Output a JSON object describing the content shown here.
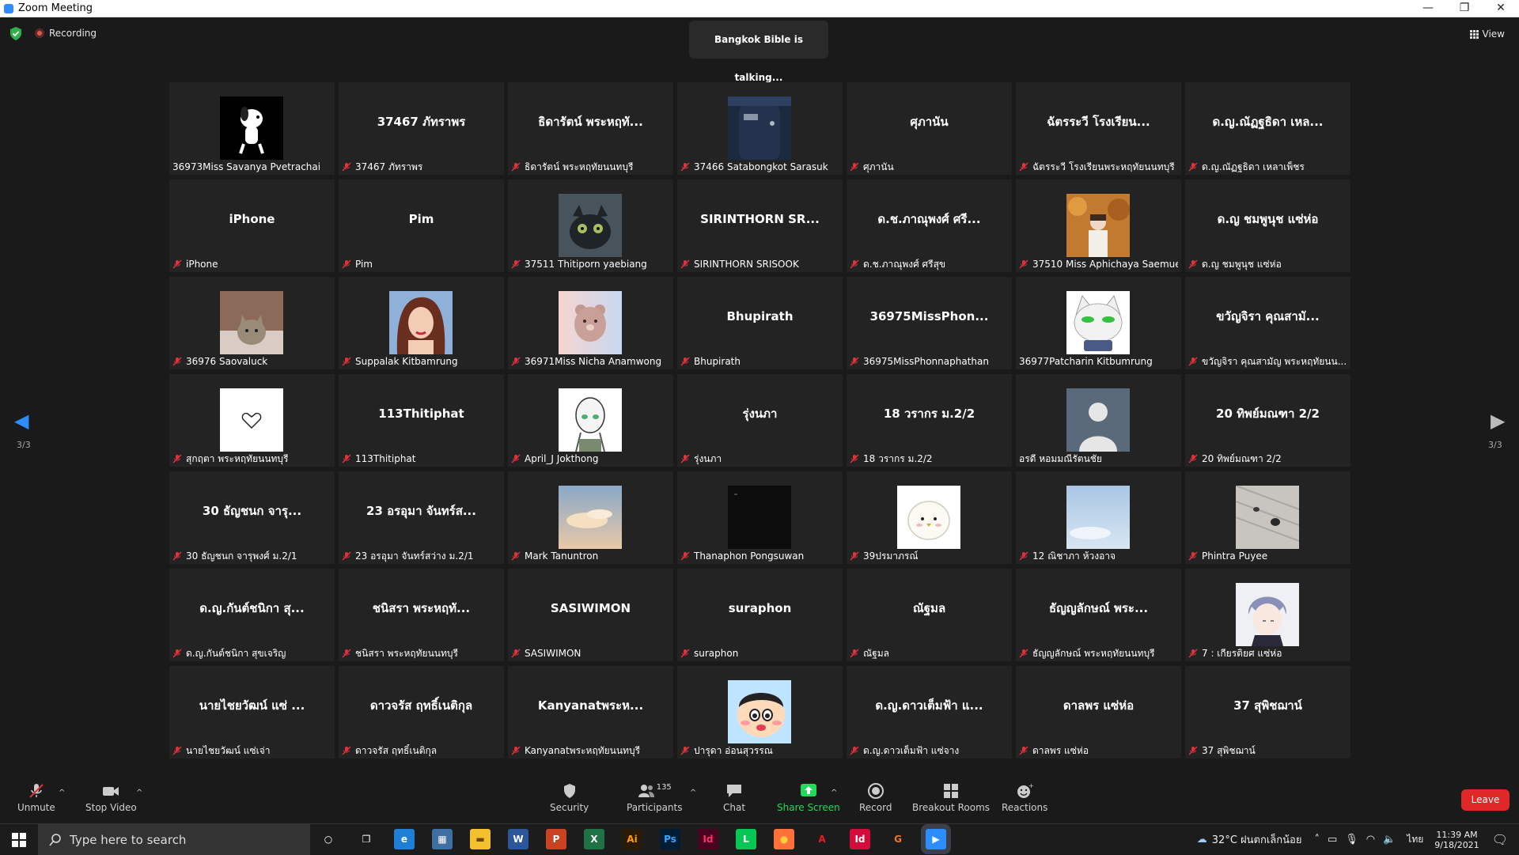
{
  "window": {
    "title": "Zoom Meeting",
    "controls": [
      "—",
      "❐",
      "✕"
    ]
  },
  "meeting": {
    "recording_label": "Recording",
    "talking_banner": "Bangkok Bible is talking...",
    "view_label": "View",
    "page_left": "3/3",
    "page_right": "3/3"
  },
  "tiles": [
    {
      "big": "",
      "label": "36973Miss Savanya Pvetrachai",
      "pic": "snoopy",
      "muted": false
    },
    {
      "big": "37467 ภัทราพร",
      "label": "37467 ภัทราพร",
      "pic": "",
      "muted": true
    },
    {
      "big": "ธิดารัตน์ พระหฤทั...",
      "label": "ธิดารัตน์ พระหฤทัยนนทบุรี",
      "pic": "",
      "muted": true
    },
    {
      "big": "",
      "label": "37466 Satabongkot Sarasuk",
      "pic": "uniform",
      "muted": true
    },
    {
      "big": "ศุภานัน",
      "label": "ศุภานัน",
      "pic": "",
      "muted": true
    },
    {
      "big": "ฉัตรระวี โรงเรียน...",
      "label": "ฉัตรระวี โรงเรียนพระหฤทัยนนทบุรี",
      "pic": "",
      "muted": true
    },
    {
      "big": "ด.ญ.ณัฏฐธิดา เหล...",
      "label": "ด.ญ.ณัฏฐธิดา เหลาเพ็ชร",
      "pic": "",
      "muted": true
    },
    {
      "big": "iPhone",
      "label": "iPhone",
      "pic": "",
      "muted": true
    },
    {
      "big": "Pim",
      "label": "Pim",
      "pic": "",
      "muted": true
    },
    {
      "big": "",
      "label": "37511 Thitiporn yaebiang",
      "pic": "toothless",
      "muted": true
    },
    {
      "big": "SIRINTHORN SR...",
      "label": "SIRINTHORN SRISOOK",
      "pic": "",
      "muted": true
    },
    {
      "big": "ด.ช.ภาณุพงศ์ ศรี...",
      "label": "ด.ช.ภาณุพงศ์ ศรีสุข",
      "pic": "",
      "muted": true
    },
    {
      "big": "",
      "label": "37510 Miss Aphichaya Saemue",
      "pic": "autumn",
      "muted": true
    },
    {
      "big": "ด.ญ ชมพูนุช แซ่ห่อ",
      "label": "ด.ญ ชมพูนุช แซ่ห่อ",
      "pic": "",
      "muted": true
    },
    {
      "big": "",
      "label": "36976 Saovaluck",
      "pic": "cat",
      "muted": true
    },
    {
      "big": "",
      "label": "Suppalak Kitbamrung",
      "pic": "belle",
      "muted": true
    },
    {
      "big": "",
      "label": "36971Miss Nicha Anamwong",
      "pic": "bear",
      "muted": true
    },
    {
      "big": "Bhupirath",
      "label": "Bhupirath",
      "pic": "",
      "muted": true
    },
    {
      "big": "36975MissPhon...",
      "label": "36975MissPhonnaphathan",
      "pic": "",
      "muted": true
    },
    {
      "big": "",
      "label": "36977Patcharin Kitbumrung",
      "pic": "whitecat",
      "muted": false
    },
    {
      "big": "ขวัญจิรา คุณสามั...",
      "label": "ขวัญจิรา คุณสามัญ พระหฤทัยนน...",
      "pic": "",
      "muted": true
    },
    {
      "big": "",
      "label": "สุกฤตา พระหฤทัยนนทบุรี",
      "pic": "heart",
      "muted": true
    },
    {
      "big": "113Thitiphat",
      "label": "113Thitiphat",
      "pic": "",
      "muted": true
    },
    {
      "big": "",
      "label": "April_J Jokthong",
      "pic": "sketch",
      "muted": true
    },
    {
      "big": "รุ่งนภา",
      "label": "รุ่งนภา",
      "pic": "",
      "muted": true
    },
    {
      "big": "18 วรากร ม.2/2",
      "label": "18 วรากร ม.2/2",
      "pic": "",
      "muted": true
    },
    {
      "big": "",
      "label": "อรดี หอมมณีรัตนชัย",
      "pic": "avatar",
      "muted": false
    },
    {
      "big": "20 ทิพย์มณฑา 2/2",
      "label": "20 ทิพย์มณฑา 2/2",
      "pic": "",
      "muted": true
    },
    {
      "big": "30 ธัญชนก  จารุ...",
      "label": "30 ธัญชนก  จารุพงศ์ ม.2/1",
      "pic": "",
      "muted": true
    },
    {
      "big": "23 อรอุมา จันทร์ส...",
      "label": "23 อรอุมา จันทร์สว่าง ม.2/1",
      "pic": "",
      "muted": true
    },
    {
      "big": "",
      "label": "Mark Tanuntron",
      "pic": "sky",
      "muted": true
    },
    {
      "big": "",
      "label": "Thanaphon Pongsuwan",
      "pic": "black",
      "muted": true
    },
    {
      "big": "",
      "label": "39ปรมาภรณ์",
      "pic": "chick",
      "muted": true
    },
    {
      "big": "",
      "label": "12 ณิชาภา ห้วงอาจ",
      "pic": "lightsky",
      "muted": true
    },
    {
      "big": "",
      "label": "Phintra Puyee",
      "pic": "snow",
      "muted": true
    },
    {
      "big": "ด.ญ.กันต์ชนิกา สุ...",
      "label": "ด.ญ.กันต์ชนิกา สุขเจริญ",
      "pic": "",
      "muted": true
    },
    {
      "big": "ชนิสรา พระหฤทั...",
      "label": "ชนิสรา พระหฤทัยนนทบุรี",
      "pic": "",
      "muted": true
    },
    {
      "big": "SASIWIMON",
      "label": "SASIWIMON",
      "pic": "",
      "muted": true
    },
    {
      "big": "suraphon",
      "label": "suraphon",
      "pic": "",
      "muted": true
    },
    {
      "big": "ณัฐมล",
      "label": "ณัฐมล",
      "pic": "",
      "muted": true
    },
    {
      "big": "ธัญญลักษณ์ พระ...",
      "label": "ธัญญลักษณ์ พระหฤทัยนนทบุรี",
      "pic": "",
      "muted": true
    },
    {
      "big": "",
      "label": "7 : เกียรติยศ แซ่ห่อ",
      "pic": "anime",
      "muted": true
    },
    {
      "big": "นายไชยวัฒน์ แซ่ ...",
      "label": "นายไชยวัฒน์ แซ่เจ่า",
      "pic": "",
      "muted": true
    },
    {
      "big": "ดาวจรัส ฤทธิ์เนติกุล",
      "label": "ดาวจรัส ฤทธิ์เนติกุล",
      "pic": "",
      "muted": true
    },
    {
      "big": "Kanyanatพระห...",
      "label": "Kanyanatพระหฤทัยนนทบุรี",
      "pic": "",
      "muted": true
    },
    {
      "big": "",
      "label": "ปารุดา อ่อนสุวรรณ",
      "pic": "shinchan",
      "muted": true
    },
    {
      "big": "ด.ญ.ดาวเต็มฟ้า แ...",
      "label": "ด.ญ.ดาวเต็มฟ้า แซ่จาง",
      "pic": "",
      "muted": true
    },
    {
      "big": "ดาลพร แซ่ห่อ",
      "label": "ดาลพร แซ่ห่อ",
      "pic": "",
      "muted": true
    },
    {
      "big": "37 สุพิชฌาน์",
      "label": "37 สุพิชฌาน์",
      "pic": "",
      "muted": true
    }
  ],
  "toolbar": {
    "unmute": "Unmute",
    "stop_video": "Stop Video",
    "security": "Security",
    "participants": "Participants",
    "participants_count": "135",
    "chat": "Chat",
    "share_screen": "Share Screen",
    "record": "Record",
    "breakout": "Breakout Rooms",
    "reactions": "Reactions",
    "leave": "Leave"
  },
  "taskbar": {
    "search_placeholder": "Type here to search",
    "apps": [
      "cortana",
      "task-view",
      "edge",
      "calculator",
      "file-explorer",
      "word",
      "powerpoint",
      "excel",
      "illustrator",
      "photoshop",
      "indesign",
      "line",
      "firefox",
      "acrobat",
      "indesign-2",
      "grammarly",
      "zoom"
    ],
    "weather": "32°C  ฝนตกเล็กน้อย",
    "lang": "ไทย",
    "time": "11:39 AM",
    "date": "9/18/2021"
  },
  "colors": {
    "accent": "#2d8cff",
    "leave": "#e02828",
    "share": "#23d959",
    "mute": "#e0323c",
    "tile": "#232323"
  }
}
